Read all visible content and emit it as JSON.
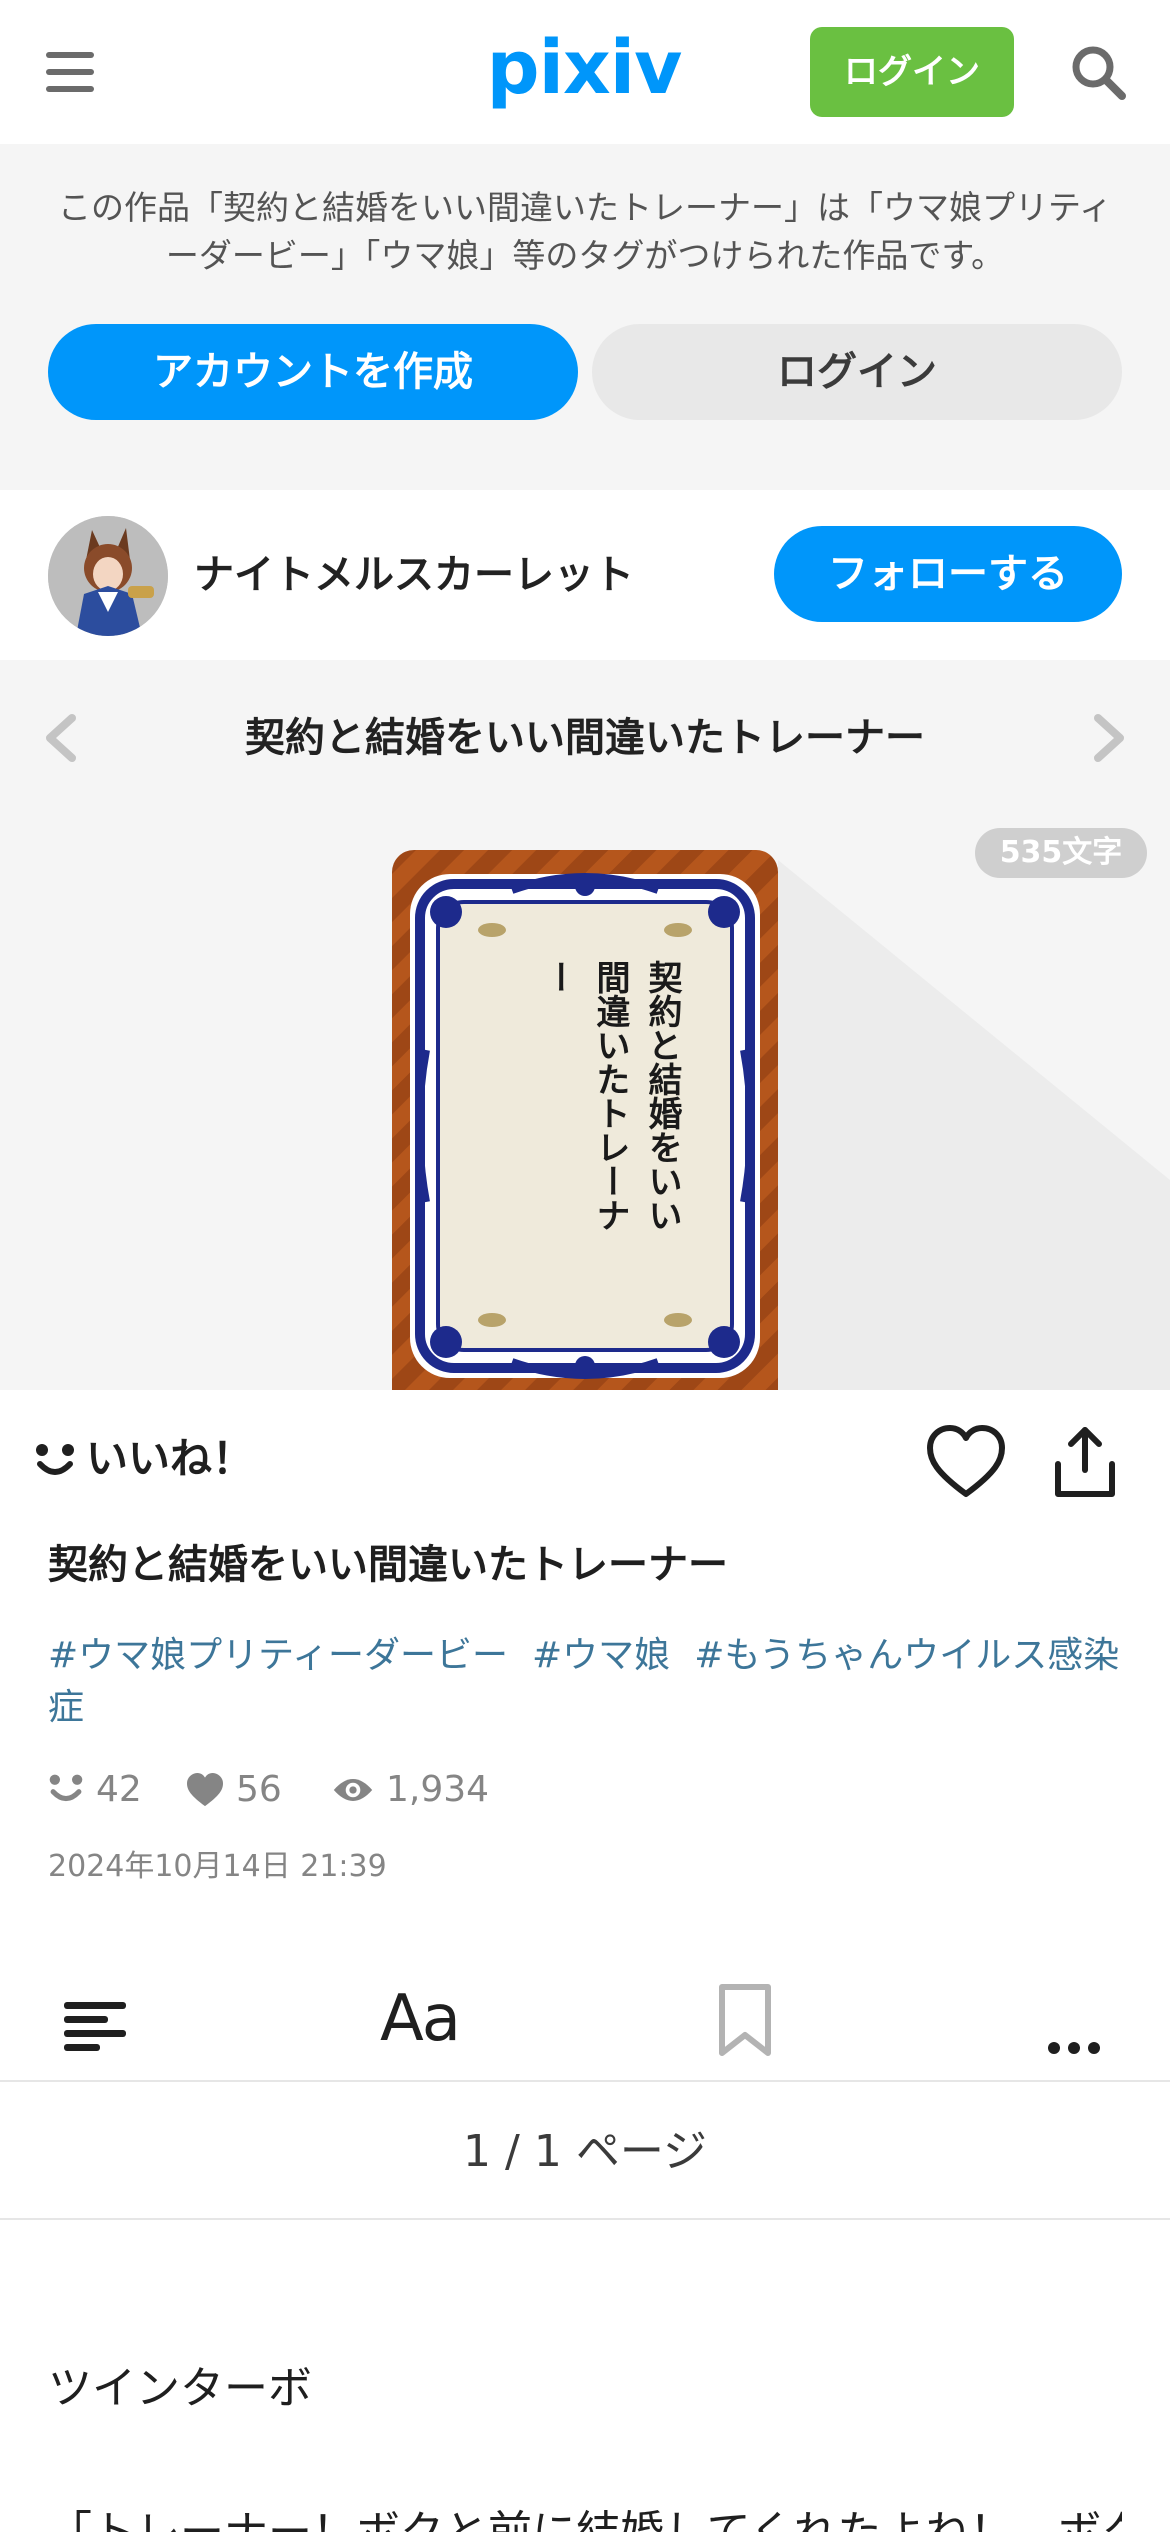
{
  "header": {
    "logo": "pixiv",
    "login_label": "ログイン",
    "search_icon": "search-icon",
    "menu_icon": "hamburger-icon",
    "logo_color": "#0096fa",
    "login_color": "#6ac041"
  },
  "promo": {
    "text": "この作品「契約と結婚をいい間違いたトレーナー」は「ウマ娘プリティーダービー」「ウマ娘」等のタグがつけられた作品です。",
    "create_account_label": "アカウントを作成",
    "login_label": "ログイン",
    "accent": "#0096fa"
  },
  "author": {
    "name": "ナイトメルスカーレット",
    "follow_label": "フォローする"
  },
  "work": {
    "title": "契約と結婚をいい間違いたトレーナー",
    "char_count": "535文字",
    "cover_title": "契約と結婚をいい間違いたトレーナー",
    "like_label": "いいね！",
    "tags": [
      "#ウマ娘プリティーダービー",
      "#ウマ娘",
      "#もうちゃんウイルス感染症"
    ],
    "stats": {
      "likes": "42",
      "bookmarks": "56",
      "views": "1,934"
    },
    "date": "2024年10月14日 21:39",
    "tag_color": "#3d7699"
  },
  "toolbar": {
    "font_label": "Aa",
    "items": [
      "toc-icon",
      "font-size-icon",
      "bookmark-icon",
      "more-icon"
    ]
  },
  "pager": {
    "label": "1 / 1 ページ"
  },
  "content": {
    "line1": "ツインターボ",
    "line2": "「トレーナー！ボクと前に結婚してくれたよね！　ボク"
  }
}
